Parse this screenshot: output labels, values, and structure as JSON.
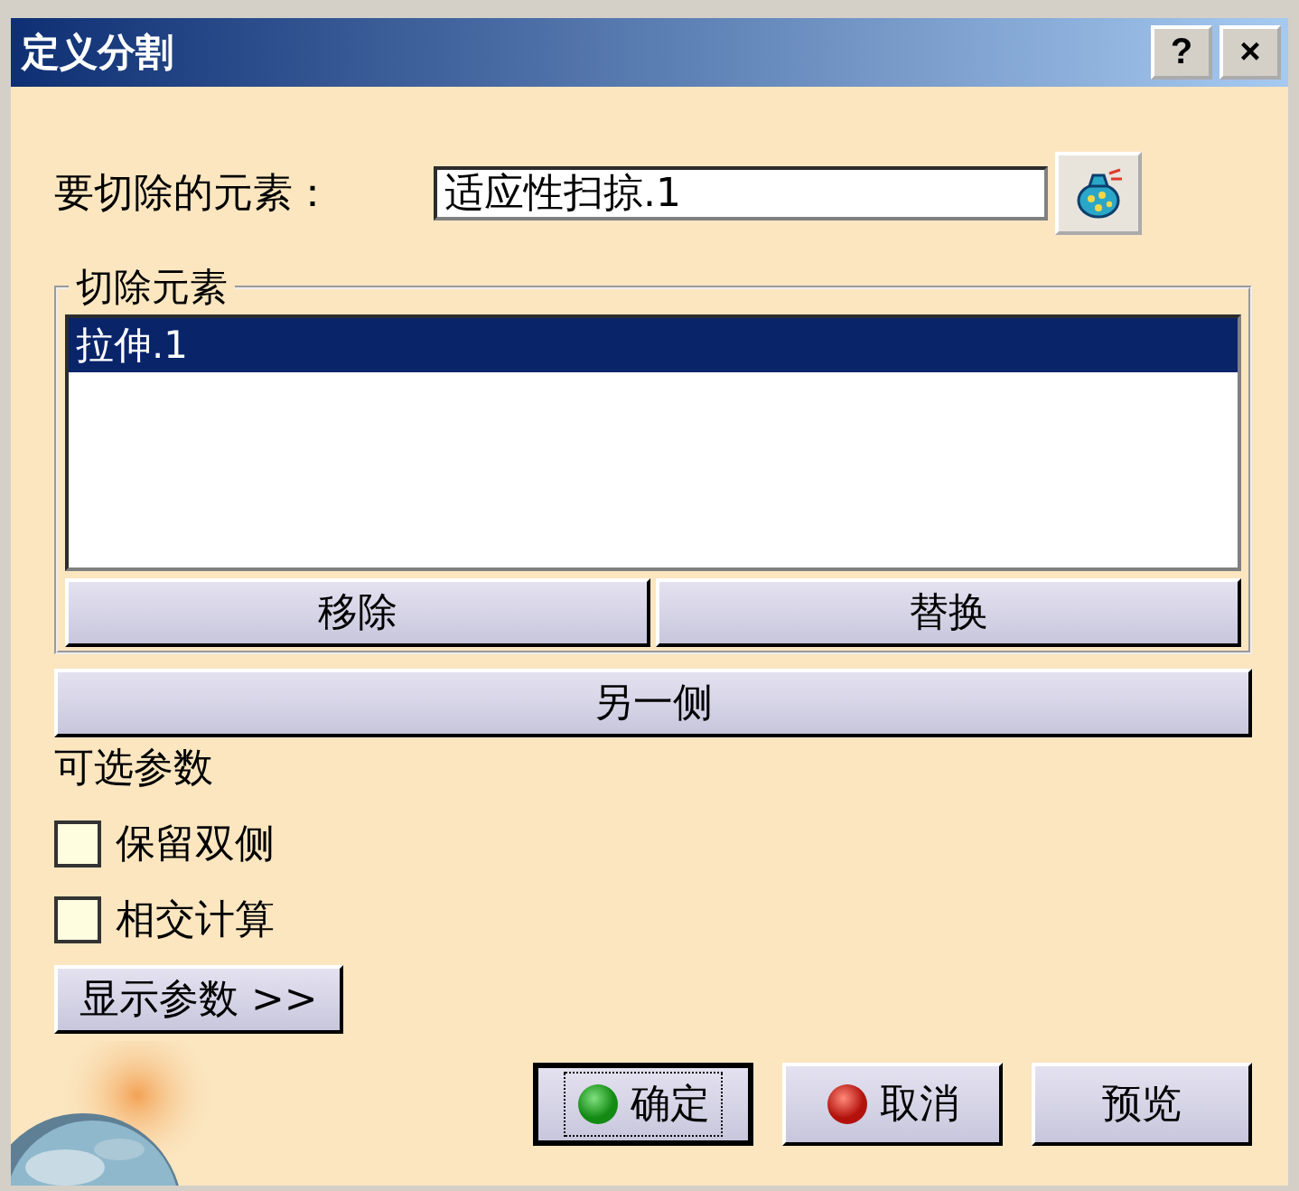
{
  "window": {
    "title": "定义分割",
    "title_buttons": [
      "?",
      "×"
    ]
  },
  "element_to_cut": {
    "label": "要切除的元素：",
    "value": "适应性扫掠.1"
  },
  "cutting_elements": {
    "legend": "切除元素",
    "items": [
      {
        "label": "拉伸.1",
        "selected": true
      }
    ],
    "buttons": [
      "移除",
      "替换"
    ]
  },
  "other_side_button": "另一侧",
  "optional": {
    "heading": "可选参数",
    "options": [
      {
        "label": "保留双侧",
        "checked": false
      },
      {
        "label": "相交计算",
        "checked": false
      }
    ],
    "show_params_button": "显示参数 >>"
  },
  "buttons": [
    {
      "label": "确定",
      "kind": "ok",
      "focused": true
    },
    {
      "label": "取消",
      "kind": "cancel",
      "focused": false
    },
    {
      "label": "预览",
      "kind": "plain",
      "focused": false
    }
  ]
}
